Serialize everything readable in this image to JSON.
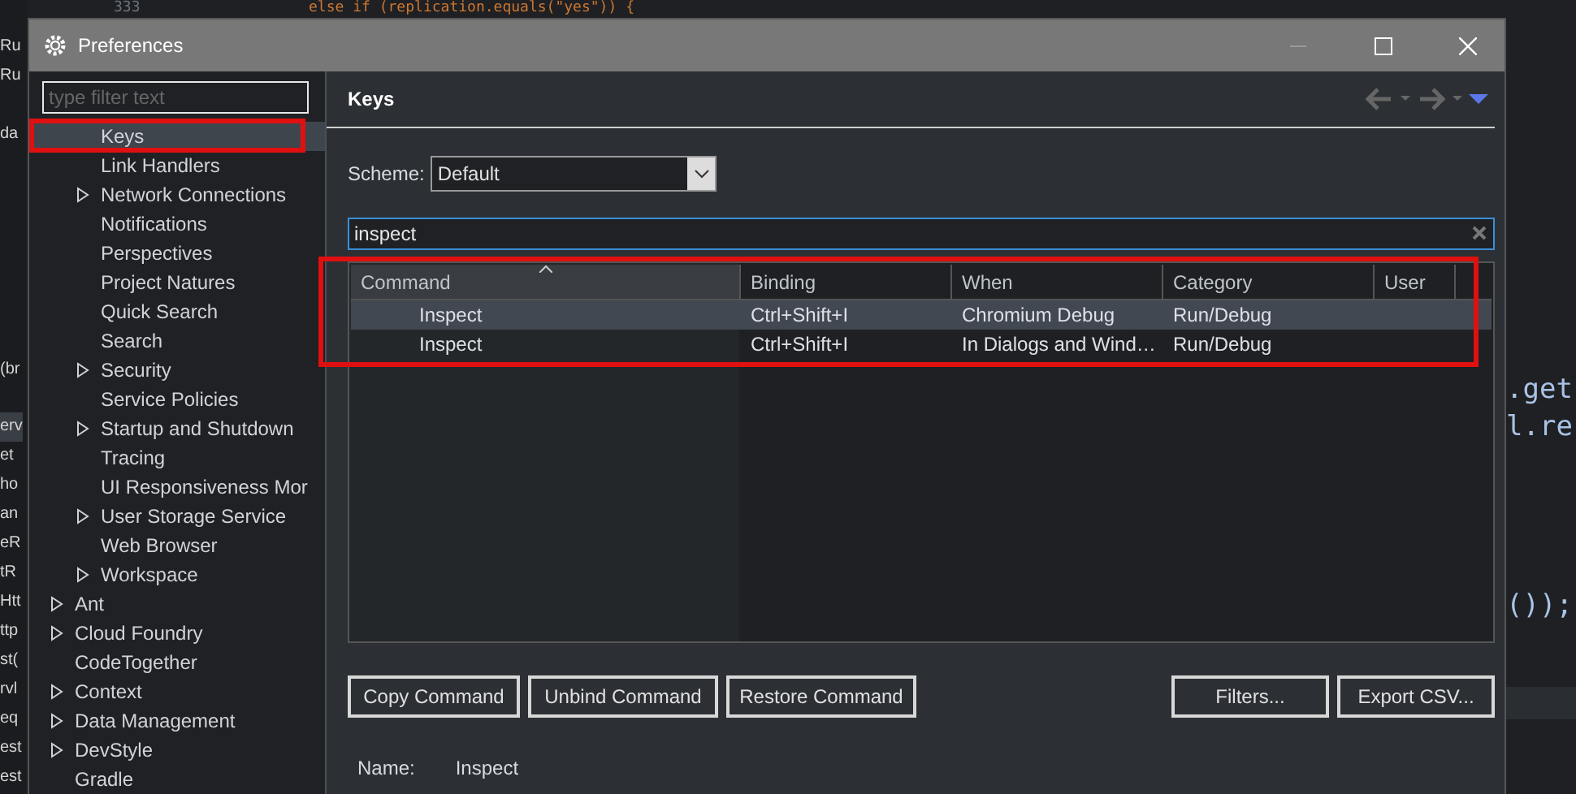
{
  "editor": {
    "top_line": {
      "number": "333",
      "code": "else if (replication.equals(\"yes\")) {"
    },
    "left_fragments": [
      "Ru",
      "Ru",
      "da",
      "(br",
      "erv",
      "et",
      "ho",
      "an",
      "eR",
      "tR",
      "Htt",
      "ttp",
      "st(",
      "rvl",
      "eq",
      "est",
      "est"
    ],
    "right_fragments": [
      ".get",
      "l.re",
      "());"
    ]
  },
  "window": {
    "title": "Preferences"
  },
  "sidebar": {
    "filter": {
      "placeholder": "type filter text"
    },
    "tree": [
      {
        "children": [
          {
            "label": "Keys",
            "expandable": false,
            "selected": true
          },
          {
            "label": "Link Handlers",
            "expandable": false,
            "selected": false
          },
          {
            "label": "Network Connections",
            "expandable": true,
            "selected": false
          },
          {
            "label": "Notifications",
            "expandable": false,
            "selected": false
          },
          {
            "label": "Perspectives",
            "expandable": false,
            "selected": false
          },
          {
            "label": "Project Natures",
            "expandable": false,
            "selected": false
          },
          {
            "label": "Quick Search",
            "expandable": false,
            "selected": false
          },
          {
            "label": "Search",
            "expandable": false,
            "selected": false
          },
          {
            "label": "Security",
            "expandable": true,
            "selected": false
          },
          {
            "label": "Service Policies",
            "expandable": false,
            "selected": false
          },
          {
            "label": "Startup and Shutdown",
            "expandable": true,
            "selected": false
          },
          {
            "label": "Tracing",
            "expandable": false,
            "selected": false
          },
          {
            "label": "UI Responsiveness Mor",
            "expandable": false,
            "selected": false
          },
          {
            "label": "User Storage Service",
            "expandable": true,
            "selected": false
          },
          {
            "label": "Web Browser",
            "expandable": false,
            "selected": false
          },
          {
            "label": "Workspace",
            "expandable": true,
            "selected": false
          }
        ]
      },
      {
        "label": "Ant",
        "expandable": true,
        "selected": false
      },
      {
        "label": "Cloud Foundry",
        "expandable": true,
        "selected": false
      },
      {
        "label": "CodeTogether",
        "expandable": false,
        "selected": false
      },
      {
        "label": "Context",
        "expandable": true,
        "selected": false
      },
      {
        "label": "Data Management",
        "expandable": true,
        "selected": false
      },
      {
        "label": "DevStyle",
        "expandable": true,
        "selected": false
      },
      {
        "label": "Gradle",
        "expandable": false,
        "selected": false
      }
    ]
  },
  "page": {
    "title": "Keys",
    "scheme": {
      "label": "Scheme:",
      "value": "Default"
    },
    "filter": {
      "value": "inspect"
    },
    "table": {
      "columns": [
        "Command",
        "Binding",
        "When",
        "Category",
        "User"
      ],
      "rows": [
        {
          "cells": [
            "Inspect",
            "Ctrl+Shift+I",
            "Chromium Debug",
            "Run/Debug",
            ""
          ],
          "selected": true
        },
        {
          "cells": [
            "Inspect",
            "Ctrl+Shift+I",
            "In Dialogs and Wind…",
            "Run/Debug",
            ""
          ],
          "selected": false
        }
      ]
    },
    "buttons_left": [
      "Copy Command",
      "Unbind Command",
      "Restore Command"
    ],
    "buttons_right": [
      "Filters...",
      "Export CSV..."
    ],
    "name": {
      "label": "Name:",
      "value": "Inspect"
    }
  }
}
